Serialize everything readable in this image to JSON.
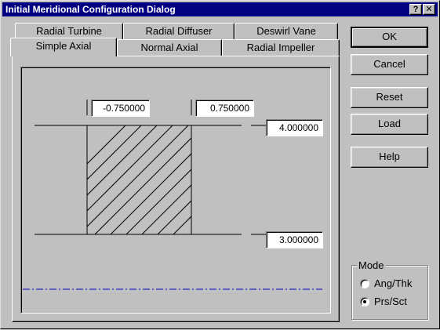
{
  "window": {
    "title": "Initial Meridional Configuration Dialog",
    "help_glyph": "?",
    "close_glyph": "✕"
  },
  "tabs": {
    "back_row": [
      {
        "label": "Radial Turbine"
      },
      {
        "label": "Radial Diffuser"
      },
      {
        "label": "Deswirl Vane"
      }
    ],
    "front_row": [
      {
        "label": "Simple Axial",
        "active": true
      },
      {
        "label": "Normal Axial"
      },
      {
        "label": "Radial Impeller"
      }
    ]
  },
  "fields": {
    "left_x": "-0.750000",
    "right_x": "0.750000",
    "top_r": "4.000000",
    "bottom_r": "3.000000"
  },
  "buttons": {
    "ok": "OK",
    "cancel": "Cancel",
    "reset": "Reset",
    "load": "Load",
    "help": "Help"
  },
  "mode": {
    "label": "Mode",
    "options": [
      {
        "label": "Ang/Thk",
        "selected": false
      },
      {
        "label": "Prs/Sct",
        "selected": true
      }
    ]
  },
  "colors": {
    "titlebar": "#000080",
    "face": "#c0c0c0",
    "axis_line": "#0000c0"
  }
}
